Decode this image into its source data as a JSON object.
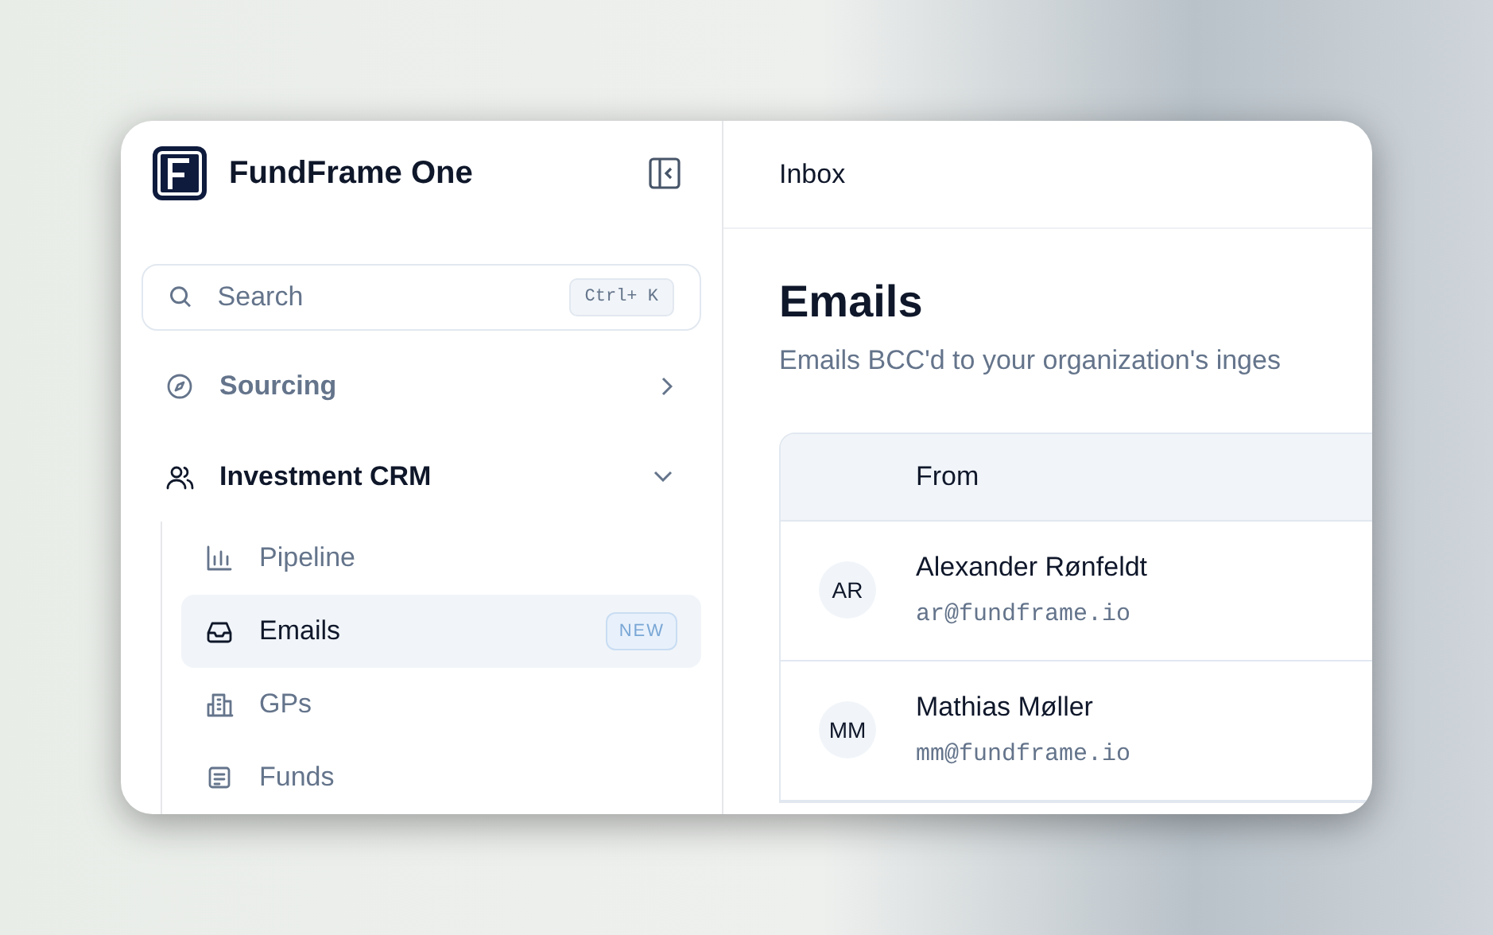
{
  "app": {
    "title": "FundFrame One"
  },
  "search": {
    "placeholder": "Search",
    "shortcut": "Ctrl+ K"
  },
  "nav": [
    {
      "label": "Sourcing",
      "kind": "compass",
      "expanded": false
    },
    {
      "label": "Investment CRM",
      "kind": "users",
      "expanded": true,
      "children": [
        {
          "label": "Pipeline",
          "kind": "chart",
          "selected": false
        },
        {
          "label": "Emails",
          "kind": "inbox",
          "selected": true,
          "badge": "NEW"
        },
        {
          "label": "GPs",
          "kind": "building",
          "selected": false
        },
        {
          "label": "Funds",
          "kind": "list",
          "selected": false
        }
      ]
    }
  ],
  "breadcrumb": "Inbox",
  "page": {
    "title": "Emails",
    "subtitle": "Emails BCC'd to your organization's inges"
  },
  "table": {
    "columns": [
      "From"
    ],
    "rows": [
      {
        "initials": "AR",
        "name": "Alexander Rønfeldt",
        "email": "ar@fundframe.io"
      },
      {
        "initials": "MM",
        "name": "Mathias Møller",
        "email": "mm@fundframe.io"
      }
    ]
  }
}
